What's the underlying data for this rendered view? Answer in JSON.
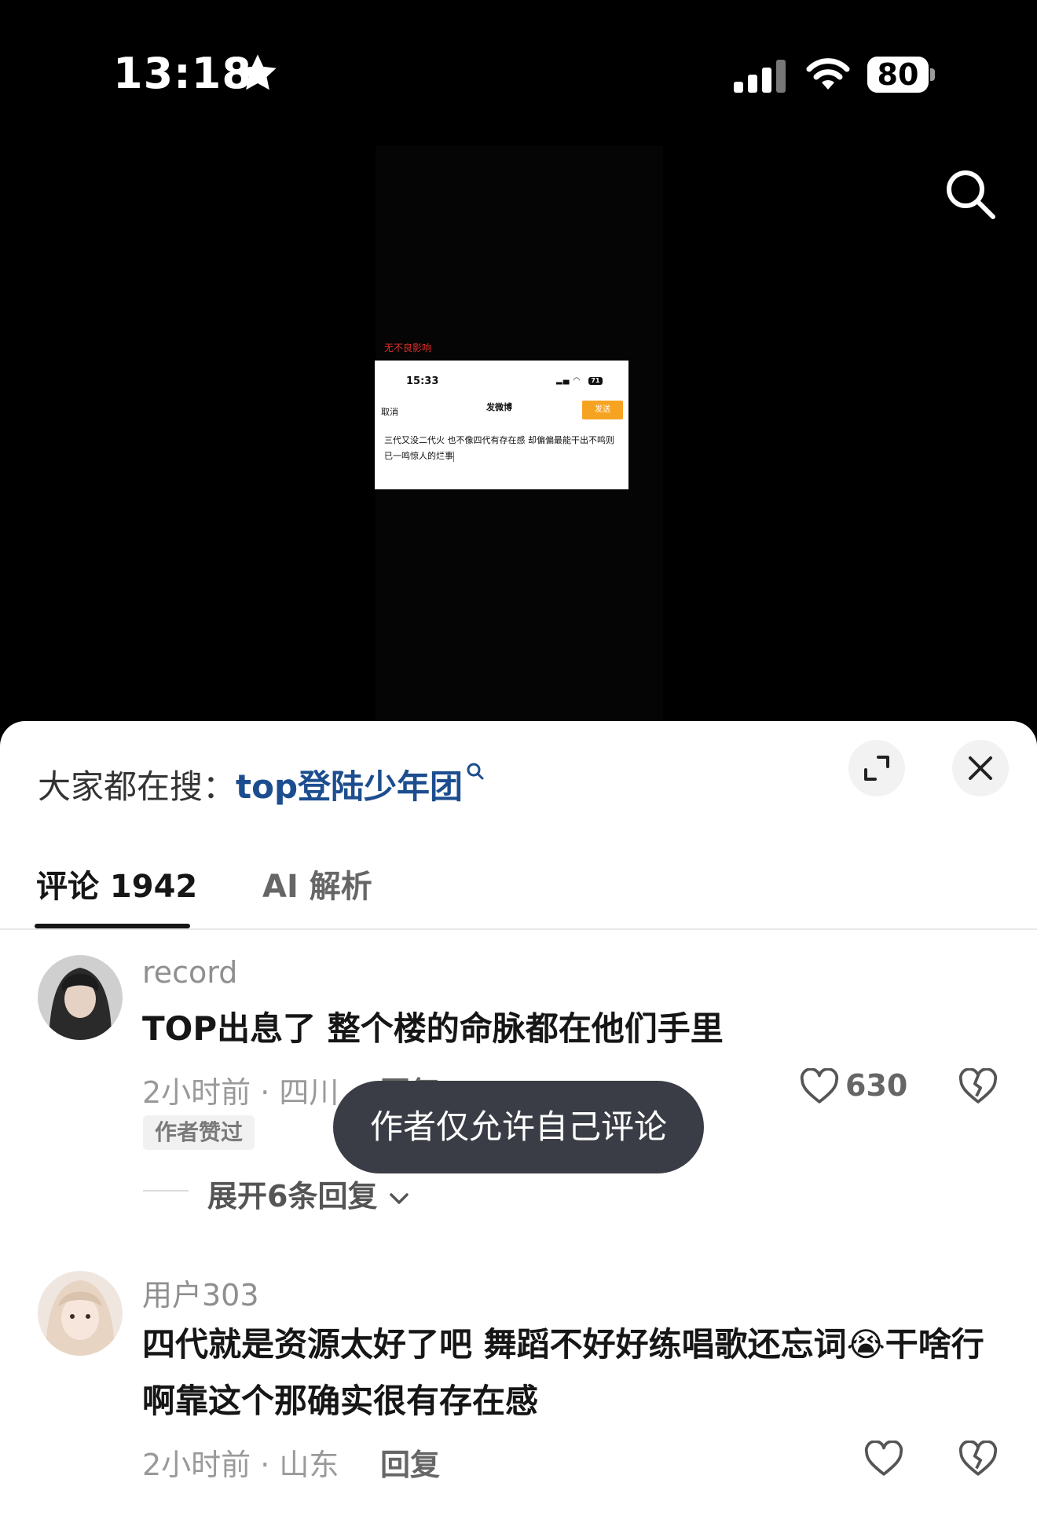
{
  "status_bar": {
    "time": "13:18",
    "battery": "80",
    "battery_level": 0.8
  },
  "video": {
    "caption": "无不良影响",
    "screenshot": {
      "time": "15:33",
      "battery": "71",
      "cancel": "取消",
      "title": "发微博",
      "send": "发送",
      "body": "三代又没二代火 也不像四代有存在感 却偏偏最能干出不鸣则已一鸣惊人的烂事"
    }
  },
  "sheet": {
    "hot_search_label": "大家都在搜：",
    "hot_search_term": "top登陆少年团",
    "tabs": [
      {
        "label": "评论 1942",
        "active": true
      },
      {
        "label": "AI 解析",
        "active": false
      }
    ]
  },
  "comments": [
    {
      "username": "record",
      "text": "TOP出息了 整个楼的命脉都在他们手里",
      "meta": "2小时前 · 四川",
      "reply": "回复",
      "badge": "作者赞过",
      "likes": "630",
      "expand_replies": "展开6条回复"
    },
    {
      "username": "用户303",
      "text": "四代就是资源太好了吧 舞蹈不好好练唱歌还忘词😭干啥行啊靠这个那确实很有存在感",
      "meta": "2小时前 · 山东",
      "reply": "回复",
      "likes": ""
    }
  ],
  "toast": "作者仅允许自己评论"
}
